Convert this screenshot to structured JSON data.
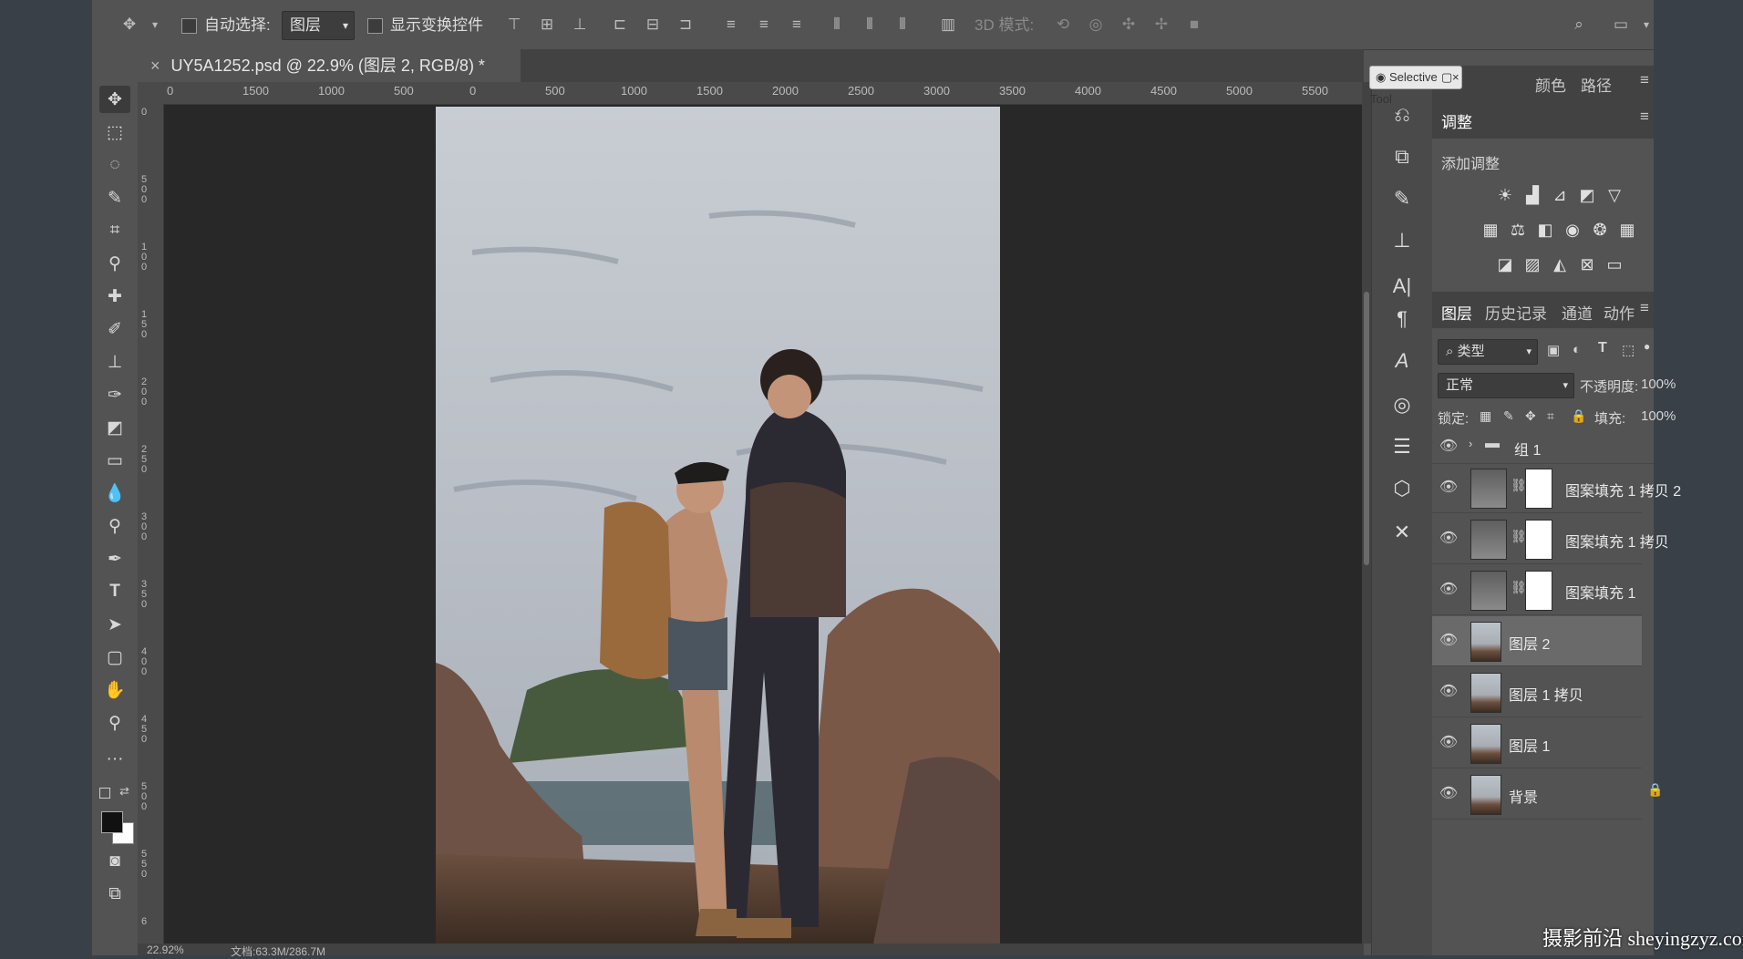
{
  "optbar": {
    "auto_select_label": "自动选择:",
    "auto_select_value": "图层",
    "show_transform_label": "显示变换控件",
    "mode_3d_label": "3D 模式:"
  },
  "document": {
    "tab_title": "UY5A1252.psd @ 22.9% (图层 2, RGB/8) *",
    "zoom": "22.92%",
    "doc_size": "文档:63.3M/286.7M"
  },
  "ruler_top": [
    "0",
    "1500",
    "1000",
    "500",
    "0",
    "500",
    "1000",
    "1500",
    "2000",
    "2500",
    "3000",
    "3500",
    "4000",
    "4500",
    "5000",
    "5500"
  ],
  "ruler_left": [
    "0",
    "5 0 0",
    "1 0 0",
    "1 5 0",
    "2 0 0",
    "2 5 0",
    "3 0 0",
    "3 5 0",
    "4 0 0",
    "4 5 0",
    "5 0 0",
    "5 5 0",
    "6"
  ],
  "floating": {
    "title": "Selective Tool"
  },
  "top_tabs": {
    "color": "颜色",
    "paths": "路径"
  },
  "adjust_panel": {
    "tab": "调整",
    "add_label": "添加调整"
  },
  "layers_panel": {
    "tabs": [
      "图层",
      "历史记录",
      "通道",
      "动作"
    ],
    "filter": "类型",
    "blend_mode": "正常",
    "opacity_label": "不透明度:",
    "opacity_value": "100%",
    "lock_label": "锁定:",
    "fill_label": "填充:",
    "fill_value": "100%",
    "group_name": "组 1",
    "layers": [
      {
        "name": "图案填充 1 拷贝 2",
        "kind": "fill"
      },
      {
        "name": "图案填充 1 拷贝",
        "kind": "fill"
      },
      {
        "name": "图案填充 1",
        "kind": "fill"
      },
      {
        "name": "图层 2",
        "kind": "photo",
        "selected": true
      },
      {
        "name": "图层 1 拷贝",
        "kind": "photo"
      },
      {
        "name": "图层 1",
        "kind": "photo"
      },
      {
        "name": "背景",
        "kind": "photo",
        "locked": true
      }
    ]
  },
  "watermark": "摄影前沿 sheyingzyz.com"
}
